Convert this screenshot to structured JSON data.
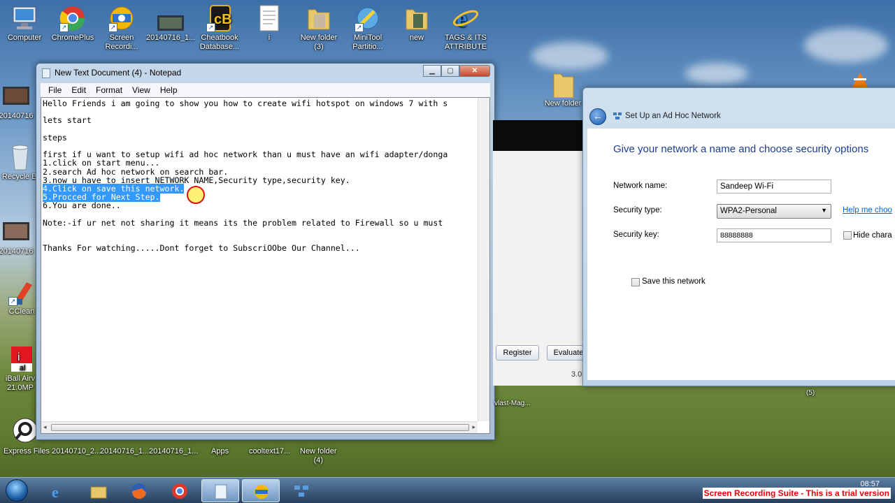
{
  "desktop_icons_top": [
    "Computer",
    "ChromePlus",
    "Screen\nRecordi...",
    "20140716_1...",
    "Cheatbook\nDatabase...",
    "i",
    "New folder\n(3)",
    "MiniTool\nPartitio...",
    "new",
    "TAGS & ITS\nATTRIBUTE"
  ],
  "desktop_icons_left": [
    "20140716",
    "Recycle Bi",
    "20140716",
    "CClean",
    "iBall Airv\n21.0MP"
  ],
  "desktop_icons_bottom": [
    "Express Files",
    "20140710_2...",
    "20140716_1...",
    "20140716_1...",
    "Apps",
    "cooltext17...",
    "New folder\n(4)"
  ],
  "desktop_extra": {
    "new_folder_right": "New folder",
    "vlast_mag": "vlast-Mag...",
    "five": "(5)"
  },
  "notepad": {
    "title": "New Text Document (4) - Notepad",
    "menu": [
      "File",
      "Edit",
      "Format",
      "View",
      "Help"
    ],
    "lines": [
      "Hello Friends i am going to show you how to create wifi hotspot on windows 7 with s",
      "",
      "lets start",
      "",
      "steps",
      "",
      "first if u want to setup wifi ad hoc network than u must have an wifi adapter/donga",
      "1.click on start menu...",
      "2.search Ad hoc network on search bar.",
      "3.now u have to insert NETWORK NAME,Security type,security key.",
      "4.Click on save this network.",
      "5.Procced for Next Step.",
      "6.You are done..",
      "",
      "Note:-if ur net not sharing it means its the problem related to Firewall so u must",
      "",
      "",
      "Thanks For watching.....Dont forget to SubscriOObe Our Channel..."
    ],
    "selected_lines": [
      10,
      11
    ]
  },
  "background_window": {
    "register": "Register",
    "evaluate": "Evaluate",
    "version": "3.0"
  },
  "adhoc": {
    "title": "Set Up an Ad Hoc Network",
    "heading": "Give your network a name and choose security options",
    "network_name_label": "Network name:",
    "network_name_value": "Sandeep Wi-Fi",
    "security_type_label": "Security type:",
    "security_type_value": "WPA2-Personal",
    "help_link": "Help me choo",
    "security_key_label": "Security key:",
    "security_key_value": "88888888",
    "hide_chars": "Hide chara",
    "save_network": "Save this network"
  },
  "taskbar": {
    "trial_text": "Screen Recording Suite - This is a trial version",
    "clock": "08:57"
  },
  "colors": {
    "selection": "#3399ff",
    "heading": "#1e3d8f",
    "trial": "#e8000b"
  }
}
